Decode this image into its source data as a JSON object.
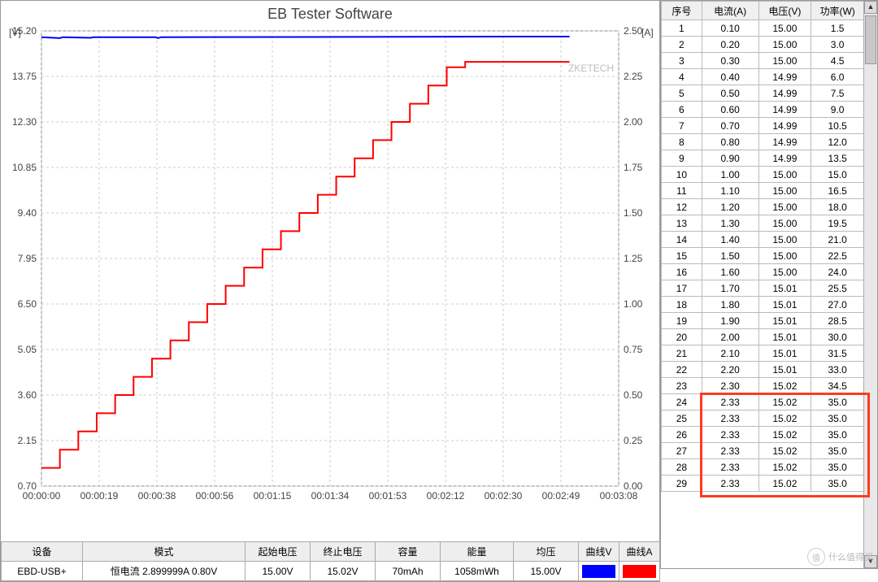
{
  "chart_data": {
    "type": "line",
    "title": "EB Tester Software",
    "watermark": "ZKETECH",
    "x_label": "",
    "left_axis": {
      "label": "[V]",
      "ticks": [
        0.7,
        2.15,
        3.6,
        5.05,
        6.5,
        7.95,
        9.4,
        10.85,
        12.3,
        13.75,
        15.2
      ]
    },
    "right_axis": {
      "label": "[A]",
      "ticks": [
        0.0,
        0.25,
        0.5,
        0.75,
        1.0,
        1.25,
        1.5,
        1.75,
        2.0,
        2.25,
        2.5
      ]
    },
    "x_ticks": [
      "00:00:00",
      "00:00:19",
      "00:00:38",
      "00:00:56",
      "00:01:15",
      "00:01:34",
      "00:01:53",
      "00:02:12",
      "00:02:30",
      "00:02:49",
      "00:03:08"
    ],
    "x_range_seconds": [
      0,
      188
    ],
    "series": [
      {
        "name": "电压(V)",
        "axis": "left",
        "color": "#0000ff",
        "approx_points": [
          {
            "t": 0,
            "v": 15.0
          },
          {
            "t": 6,
            "v": 14.97
          },
          {
            "t": 7,
            "v": 15.0
          },
          {
            "t": 16,
            "v": 14.98
          },
          {
            "t": 17,
            "v": 15.0
          },
          {
            "t": 37,
            "v": 15.0
          },
          {
            "t": 38,
            "v": 14.97
          },
          {
            "t": 39,
            "v": 15.0
          },
          {
            "t": 171,
            "v": 15.02
          },
          {
            "t": 172,
            "v": 15.02
          }
        ]
      },
      {
        "name": "电流(A)",
        "axis": "right",
        "color": "#ff0000",
        "approx_points": [
          {
            "t": 0,
            "v": 0.1
          },
          {
            "t": 6,
            "v": 0.1
          },
          {
            "t": 6,
            "v": 0.2
          },
          {
            "t": 12,
            "v": 0.2
          },
          {
            "t": 12,
            "v": 0.3
          },
          {
            "t": 18,
            "v": 0.3
          },
          {
            "t": 18,
            "v": 0.4
          },
          {
            "t": 24,
            "v": 0.4
          },
          {
            "t": 24,
            "v": 0.5
          },
          {
            "t": 30,
            "v": 0.5
          },
          {
            "t": 30,
            "v": 0.6
          },
          {
            "t": 36,
            "v": 0.6
          },
          {
            "t": 36,
            "v": 0.7
          },
          {
            "t": 42,
            "v": 0.7
          },
          {
            "t": 42,
            "v": 0.8
          },
          {
            "t": 48,
            "v": 0.8
          },
          {
            "t": 48,
            "v": 0.9
          },
          {
            "t": 54,
            "v": 0.9
          },
          {
            "t": 54,
            "v": 1.0
          },
          {
            "t": 60,
            "v": 1.0
          },
          {
            "t": 60,
            "v": 1.1
          },
          {
            "t": 66,
            "v": 1.1
          },
          {
            "t": 66,
            "v": 1.2
          },
          {
            "t": 72,
            "v": 1.2
          },
          {
            "t": 72,
            "v": 1.3
          },
          {
            "t": 78,
            "v": 1.3
          },
          {
            "t": 78,
            "v": 1.4
          },
          {
            "t": 84,
            "v": 1.4
          },
          {
            "t": 84,
            "v": 1.5
          },
          {
            "t": 90,
            "v": 1.5
          },
          {
            "t": 90,
            "v": 1.6
          },
          {
            "t": 96,
            "v": 1.6
          },
          {
            "t": 96,
            "v": 1.7
          },
          {
            "t": 102,
            "v": 1.7
          },
          {
            "t": 102,
            "v": 1.8
          },
          {
            "t": 108,
            "v": 1.8
          },
          {
            "t": 108,
            "v": 1.9
          },
          {
            "t": 114,
            "v": 1.9
          },
          {
            "t": 114,
            "v": 2.0
          },
          {
            "t": 120,
            "v": 2.0
          },
          {
            "t": 120,
            "v": 2.1
          },
          {
            "t": 126,
            "v": 2.1
          },
          {
            "t": 126,
            "v": 2.2
          },
          {
            "t": 132,
            "v": 2.2
          },
          {
            "t": 132,
            "v": 2.3
          },
          {
            "t": 138,
            "v": 2.3
          },
          {
            "t": 138,
            "v": 2.33
          },
          {
            "t": 172,
            "v": 2.33
          }
        ]
      }
    ]
  },
  "summary": {
    "headers": {
      "device": "设备",
      "mode": "模式",
      "startV": "起始电压",
      "endV": "终止电压",
      "capacity": "容量",
      "energy": "能量",
      "avgV": "均压",
      "curveV": "曲线V",
      "curveA": "曲线A"
    },
    "values": {
      "device": "EBD-USB+",
      "mode": "恒电流  2.899999A  0.80V",
      "startV": "15.00V",
      "endV": "15.02V",
      "capacity": "70mAh",
      "energy": "1058mWh",
      "avgV": "15.00V"
    },
    "colors": {
      "curveV": "#0000ff",
      "curveA": "#ff0000"
    }
  },
  "table": {
    "headers": {
      "idx": "序号",
      "current": "电流(A)",
      "voltage": "电压(V)",
      "power": "功率(W)"
    },
    "rows": [
      {
        "idx": 1,
        "current": "0.10",
        "voltage": "15.00",
        "power": "1.5"
      },
      {
        "idx": 2,
        "current": "0.20",
        "voltage": "15.00",
        "power": "3.0"
      },
      {
        "idx": 3,
        "current": "0.30",
        "voltage": "15.00",
        "power": "4.5"
      },
      {
        "idx": 4,
        "current": "0.40",
        "voltage": "14.99",
        "power": "6.0"
      },
      {
        "idx": 5,
        "current": "0.50",
        "voltage": "14.99",
        "power": "7.5"
      },
      {
        "idx": 6,
        "current": "0.60",
        "voltage": "14.99",
        "power": "9.0"
      },
      {
        "idx": 7,
        "current": "0.70",
        "voltage": "14.99",
        "power": "10.5"
      },
      {
        "idx": 8,
        "current": "0.80",
        "voltage": "14.99",
        "power": "12.0"
      },
      {
        "idx": 9,
        "current": "0.90",
        "voltage": "14.99",
        "power": "13.5"
      },
      {
        "idx": 10,
        "current": "1.00",
        "voltage": "15.00",
        "power": "15.0"
      },
      {
        "idx": 11,
        "current": "1.10",
        "voltage": "15.00",
        "power": "16.5"
      },
      {
        "idx": 12,
        "current": "1.20",
        "voltage": "15.00",
        "power": "18.0"
      },
      {
        "idx": 13,
        "current": "1.30",
        "voltage": "15.00",
        "power": "19.5"
      },
      {
        "idx": 14,
        "current": "1.40",
        "voltage": "15.00",
        "power": "21.0"
      },
      {
        "idx": 15,
        "current": "1.50",
        "voltage": "15.00",
        "power": "22.5"
      },
      {
        "idx": 16,
        "current": "1.60",
        "voltage": "15.00",
        "power": "24.0"
      },
      {
        "idx": 17,
        "current": "1.70",
        "voltage": "15.01",
        "power": "25.5"
      },
      {
        "idx": 18,
        "current": "1.80",
        "voltage": "15.01",
        "power": "27.0"
      },
      {
        "idx": 19,
        "current": "1.90",
        "voltage": "15.01",
        "power": "28.5"
      },
      {
        "idx": 20,
        "current": "2.00",
        "voltage": "15.01",
        "power": "30.0"
      },
      {
        "idx": 21,
        "current": "2.10",
        "voltage": "15.01",
        "power": "31.5"
      },
      {
        "idx": 22,
        "current": "2.20",
        "voltage": "15.01",
        "power": "33.0"
      },
      {
        "idx": 23,
        "current": "2.30",
        "voltage": "15.02",
        "power": "34.5"
      },
      {
        "idx": 24,
        "current": "2.33",
        "voltage": "15.02",
        "power": "35.0"
      },
      {
        "idx": 25,
        "current": "2.33",
        "voltage": "15.02",
        "power": "35.0"
      },
      {
        "idx": 26,
        "current": "2.33",
        "voltage": "15.02",
        "power": "35.0"
      },
      {
        "idx": 27,
        "current": "2.33",
        "voltage": "15.02",
        "power": "35.0"
      },
      {
        "idx": 28,
        "current": "2.33",
        "voltage": "15.02",
        "power": "35.0"
      },
      {
        "idx": 29,
        "current": "2.33",
        "voltage": "15.02",
        "power": "35.0"
      }
    ],
    "highlight_rows": [
      24,
      25,
      26,
      27,
      28,
      29
    ]
  },
  "smzdm_text": "什么值得买"
}
